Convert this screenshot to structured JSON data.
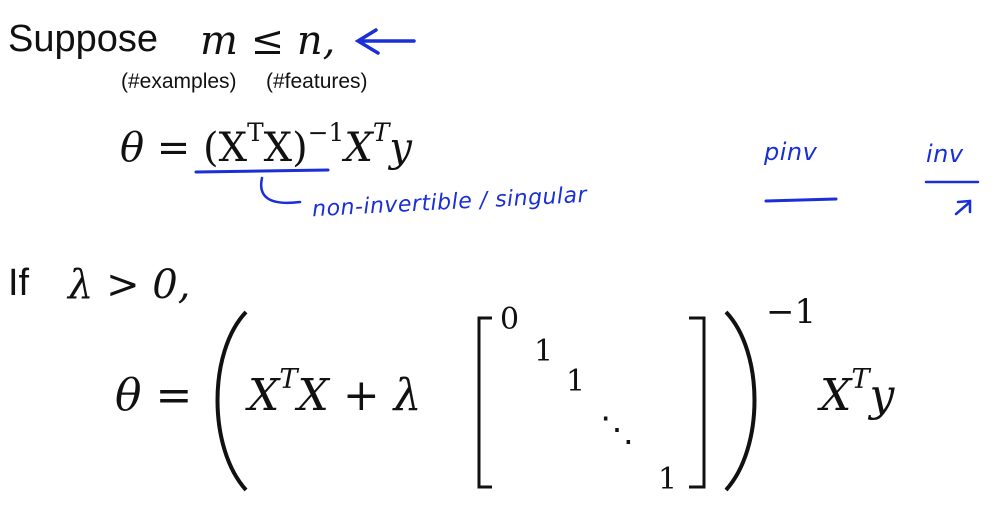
{
  "slide": {
    "suppose_word": "Suppose",
    "condition": "m ≤ n,",
    "m_note": "(#examples)",
    "n_note": "(#features)",
    "theta_lhs": "θ =",
    "normal_eq_paren": "(X",
    "normal_eq_T1": "T",
    "normal_eq_mid": "X)",
    "normal_eq_inv": "−1",
    "normal_eq_X2": "X",
    "normal_eq_T2": "T",
    "normal_eq_y": "y",
    "if_word": "If",
    "lambda_cond": "λ > 0,",
    "reg_theta": "θ =",
    "reg_XT": "X",
    "reg_T": "T",
    "reg_X_plus_lambda": "X + λ",
    "matrix_entries": [
      "0",
      "1",
      "1",
      "⋱",
      "1"
    ],
    "reg_outer_inv": "−1",
    "reg_rhs_X": "X",
    "reg_rhs_T": "T",
    "reg_rhs_y": "y"
  },
  "annotations": {
    "ink_color": "#1a2fd6",
    "non_invertible_note": "non-invertible / singular",
    "pinv_note": "pinv",
    "inv_note": "inv"
  }
}
